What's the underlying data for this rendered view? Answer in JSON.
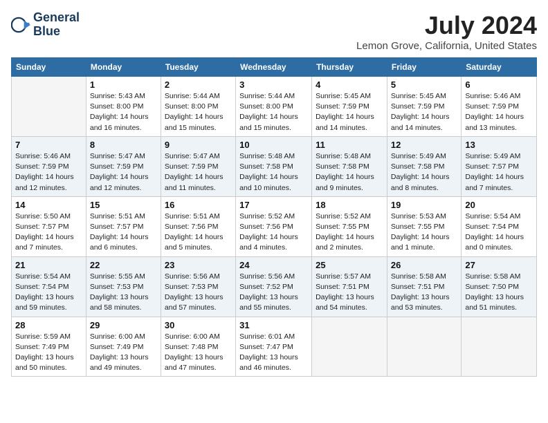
{
  "header": {
    "logo_line1": "General",
    "logo_line2": "Blue",
    "month_year": "July 2024",
    "location": "Lemon Grove, California, United States"
  },
  "days_of_week": [
    "Sunday",
    "Monday",
    "Tuesday",
    "Wednesday",
    "Thursday",
    "Friday",
    "Saturday"
  ],
  "weeks": [
    [
      {
        "date": "",
        "info": ""
      },
      {
        "date": "1",
        "info": "Sunrise: 5:43 AM\nSunset: 8:00 PM\nDaylight: 14 hours\nand 16 minutes."
      },
      {
        "date": "2",
        "info": "Sunrise: 5:44 AM\nSunset: 8:00 PM\nDaylight: 14 hours\nand 15 minutes."
      },
      {
        "date": "3",
        "info": "Sunrise: 5:44 AM\nSunset: 8:00 PM\nDaylight: 14 hours\nand 15 minutes."
      },
      {
        "date": "4",
        "info": "Sunrise: 5:45 AM\nSunset: 7:59 PM\nDaylight: 14 hours\nand 14 minutes."
      },
      {
        "date": "5",
        "info": "Sunrise: 5:45 AM\nSunset: 7:59 PM\nDaylight: 14 hours\nand 14 minutes."
      },
      {
        "date": "6",
        "info": "Sunrise: 5:46 AM\nSunset: 7:59 PM\nDaylight: 14 hours\nand 13 minutes."
      }
    ],
    [
      {
        "date": "7",
        "info": "Sunrise: 5:46 AM\nSunset: 7:59 PM\nDaylight: 14 hours\nand 12 minutes."
      },
      {
        "date": "8",
        "info": "Sunrise: 5:47 AM\nSunset: 7:59 PM\nDaylight: 14 hours\nand 12 minutes."
      },
      {
        "date": "9",
        "info": "Sunrise: 5:47 AM\nSunset: 7:59 PM\nDaylight: 14 hours\nand 11 minutes."
      },
      {
        "date": "10",
        "info": "Sunrise: 5:48 AM\nSunset: 7:58 PM\nDaylight: 14 hours\nand 10 minutes."
      },
      {
        "date": "11",
        "info": "Sunrise: 5:48 AM\nSunset: 7:58 PM\nDaylight: 14 hours\nand 9 minutes."
      },
      {
        "date": "12",
        "info": "Sunrise: 5:49 AM\nSunset: 7:58 PM\nDaylight: 14 hours\nand 8 minutes."
      },
      {
        "date": "13",
        "info": "Sunrise: 5:49 AM\nSunset: 7:57 PM\nDaylight: 14 hours\nand 7 minutes."
      }
    ],
    [
      {
        "date": "14",
        "info": "Sunrise: 5:50 AM\nSunset: 7:57 PM\nDaylight: 14 hours\nand 7 minutes."
      },
      {
        "date": "15",
        "info": "Sunrise: 5:51 AM\nSunset: 7:57 PM\nDaylight: 14 hours\nand 6 minutes."
      },
      {
        "date": "16",
        "info": "Sunrise: 5:51 AM\nSunset: 7:56 PM\nDaylight: 14 hours\nand 5 minutes."
      },
      {
        "date": "17",
        "info": "Sunrise: 5:52 AM\nSunset: 7:56 PM\nDaylight: 14 hours\nand 4 minutes."
      },
      {
        "date": "18",
        "info": "Sunrise: 5:52 AM\nSunset: 7:55 PM\nDaylight: 14 hours\nand 2 minutes."
      },
      {
        "date": "19",
        "info": "Sunrise: 5:53 AM\nSunset: 7:55 PM\nDaylight: 14 hours\nand 1 minute."
      },
      {
        "date": "20",
        "info": "Sunrise: 5:54 AM\nSunset: 7:54 PM\nDaylight: 14 hours\nand 0 minutes."
      }
    ],
    [
      {
        "date": "21",
        "info": "Sunrise: 5:54 AM\nSunset: 7:54 PM\nDaylight: 13 hours\nand 59 minutes."
      },
      {
        "date": "22",
        "info": "Sunrise: 5:55 AM\nSunset: 7:53 PM\nDaylight: 13 hours\nand 58 minutes."
      },
      {
        "date": "23",
        "info": "Sunrise: 5:56 AM\nSunset: 7:53 PM\nDaylight: 13 hours\nand 57 minutes."
      },
      {
        "date": "24",
        "info": "Sunrise: 5:56 AM\nSunset: 7:52 PM\nDaylight: 13 hours\nand 55 minutes."
      },
      {
        "date": "25",
        "info": "Sunrise: 5:57 AM\nSunset: 7:51 PM\nDaylight: 13 hours\nand 54 minutes."
      },
      {
        "date": "26",
        "info": "Sunrise: 5:58 AM\nSunset: 7:51 PM\nDaylight: 13 hours\nand 53 minutes."
      },
      {
        "date": "27",
        "info": "Sunrise: 5:58 AM\nSunset: 7:50 PM\nDaylight: 13 hours\nand 51 minutes."
      }
    ],
    [
      {
        "date": "28",
        "info": "Sunrise: 5:59 AM\nSunset: 7:49 PM\nDaylight: 13 hours\nand 50 minutes."
      },
      {
        "date": "29",
        "info": "Sunrise: 6:00 AM\nSunset: 7:49 PM\nDaylight: 13 hours\nand 49 minutes."
      },
      {
        "date": "30",
        "info": "Sunrise: 6:00 AM\nSunset: 7:48 PM\nDaylight: 13 hours\nand 47 minutes."
      },
      {
        "date": "31",
        "info": "Sunrise: 6:01 AM\nSunset: 7:47 PM\nDaylight: 13 hours\nand 46 minutes."
      },
      {
        "date": "",
        "info": ""
      },
      {
        "date": "",
        "info": ""
      },
      {
        "date": "",
        "info": ""
      }
    ]
  ]
}
